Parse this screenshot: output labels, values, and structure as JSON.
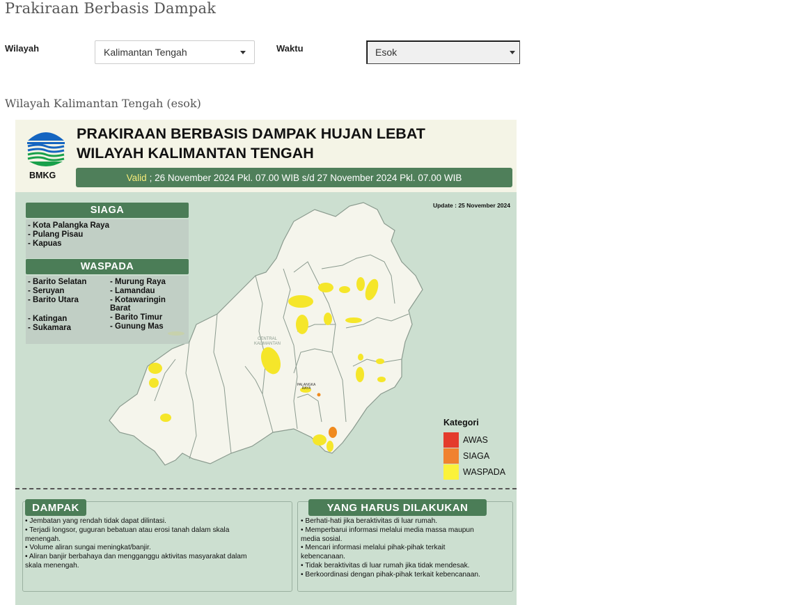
{
  "page": {
    "title": "Prakiraan Berbasis Dampak",
    "subtitle": "Wilayah Kalimantan Tengah (esok)"
  },
  "filters": {
    "wilayah_label": "Wilayah",
    "wilayah_value": "Kalimantan Tengah",
    "waktu_label": "Waktu",
    "waktu_value": "Esok"
  },
  "infographic": {
    "title_line1": "PRAKIRAAN BERBASIS DAMPAK HUJAN LEBAT",
    "title_line2": "WILAYAH KALIMANTAN TENGAH",
    "logo_text": "BMKG",
    "valid_label": "Valid",
    "valid_text": "; 26 November 2024 Pkl. 07.00 WIB s/d 27 November 2024 Pkl. 07.00 WIB",
    "update": "Update : 25 November 2024",
    "map_label_province_1": "CENTRAL",
    "map_label_province_2": "KALIMANTAN",
    "map_label_city_1": "PALANGKA",
    "map_label_city_2": "RAYA",
    "siaga": {
      "heading": "SIAGA",
      "items": [
        "- Kota Palangka Raya",
        "- Pulang Pisau",
        "- Kapuas"
      ]
    },
    "waspada": {
      "heading": "WASPADA",
      "col1": [
        "- Barito Selatan",
        "- Seruyan",
        "- Barito Utara",
        "",
        "- Katingan",
        "- Sukamara"
      ],
      "col2": [
        "- Murung Raya",
        "- Lamandau",
        "- Kotawaringin",
        "Barat",
        "- Barito Timur",
        "- Gunung Mas"
      ]
    },
    "legend": {
      "title": "Kategori",
      "items": [
        {
          "label": "AWAS",
          "color": "#e43b2c"
        },
        {
          "label": "SIAGA",
          "color": "#f0822f"
        },
        {
          "label": "WASPADA",
          "color": "#fbf23b"
        }
      ]
    },
    "dampak": {
      "heading": "DAMPAK",
      "lines": [
        "• Jembatan yang rendah tidak dapat dilintasi.",
        "• Terjadi longsor, guguran bebatuan atau erosi tanah dalam skala",
        "menengah.",
        "• Volume aliran sungai meningkat/banjir.",
        "• Aliran banjir berbahaya dan mengganggu aktivitas masyarakat dalam",
        "skala menengah."
      ]
    },
    "tindakan": {
      "heading": "YANG HARUS DILAKUKAN",
      "lines": [
        "• Berhati-hati jika beraktivitas di luar rumah.",
        "• Memperbarui informasi melalui media massa maupun",
        "media sosial.",
        "• Mencari informasi melalui pihak-pihak terkait",
        "kebencanaan.",
        "• Tidak beraktivitas di luar rumah jika tidak mendesak.",
        "• Berkoordinasi dengan pihak-pihak terkait kebencanaan."
      ]
    }
  }
}
